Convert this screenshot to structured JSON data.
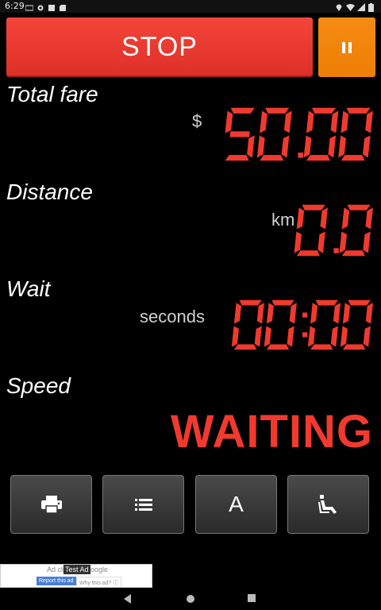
{
  "status_bar": {
    "time": "6:29",
    "left_icons": [
      "network-icon",
      "settings-icon",
      "app-icon",
      "sd-card-icon"
    ],
    "right_icons": [
      "location-icon",
      "wifi-icon",
      "signal-icon",
      "battery-icon"
    ]
  },
  "controls": {
    "stop_label": "STOP",
    "pause_icon": "pause-icon"
  },
  "fare": {
    "label": "Total fare",
    "currency": "$",
    "value": "50.00"
  },
  "distance": {
    "label": "Distance",
    "unit": "km",
    "value": "0.0"
  },
  "wait": {
    "label": "Wait",
    "unit": "seconds",
    "value": "00:00"
  },
  "speed": {
    "label": "Speed",
    "status": "WAITING"
  },
  "toolbar": {
    "print_icon": "print-icon",
    "list_icon": "list-icon",
    "font_label": "A",
    "seat_icon": "seat-icon"
  },
  "ad": {
    "text_left": "Ad cli",
    "text_right": "oogle",
    "badge": "Test Ad",
    "report": "Report this ad",
    "why": "Why this ad? ⓘ"
  },
  "colors": {
    "accent_red": "#f03a2e",
    "stop_red": "#e83a30",
    "pause_orange": "#f28a0c",
    "segment_red": "#f03a2e"
  }
}
